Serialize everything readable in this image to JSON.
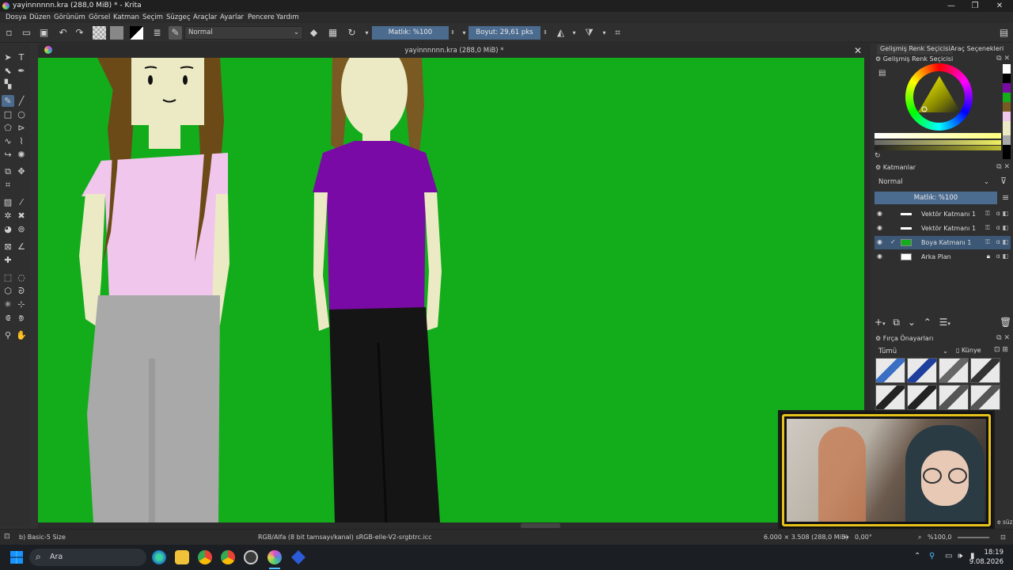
{
  "window": {
    "title": "yayinnnnnn.kra (288,0 MiB) * - Krita",
    "controls": [
      "—",
      "❐",
      "✕"
    ]
  },
  "menu": [
    "Dosya",
    "Düzen",
    "Görünüm",
    "Görsel",
    "Katman",
    "Seçim",
    "Süzgeç",
    "Araçlar",
    "Ayarlar",
    "Pencere",
    "Yardım"
  ],
  "toolbar": {
    "blend_mode": "Normal",
    "opacity": "Matlık: %100",
    "size": "Boyut: 29,61 pks"
  },
  "document": {
    "tab_title": "yayinnnnnn.kra (288,0 MiB) *"
  },
  "dock": {
    "tabs": [
      "Gelişmiş Renk Seçicisi",
      "Araç Seçenekleri"
    ],
    "color_selector_title": "Gelişmiş Renk Seçicisi",
    "layers_title": "Katmanlar",
    "layers_blend": "Normal",
    "layers_opacity": "Matlık: %100",
    "layers": [
      {
        "name": "Vektör Katmanı 1",
        "selected": false
      },
      {
        "name": "Vektör Katmanı 1",
        "selected": false
      },
      {
        "name": "Boya Katmanı 1",
        "selected": true
      },
      {
        "name": "Arka Plan",
        "selected": false
      }
    ],
    "brush_title": "Fırça Önayarları",
    "brush_filter": "Tümü",
    "brush_tag": "Künye",
    "brush_search_hint": "e süz"
  },
  "status": {
    "brush": "b) Basic-5 Size",
    "color_profile": "RGB/Alfa (8 bit tamsayı/kanal) sRGB-elle-V2-srgbtrc.icc",
    "dimensions": "6.000 × 3.508 (288,0 MiB)",
    "rotation": "0,00°",
    "zoom": "%100,0"
  },
  "taskbar": {
    "search_placeholder": "Ara",
    "time": "18:19",
    "date": "9.08.2026"
  }
}
